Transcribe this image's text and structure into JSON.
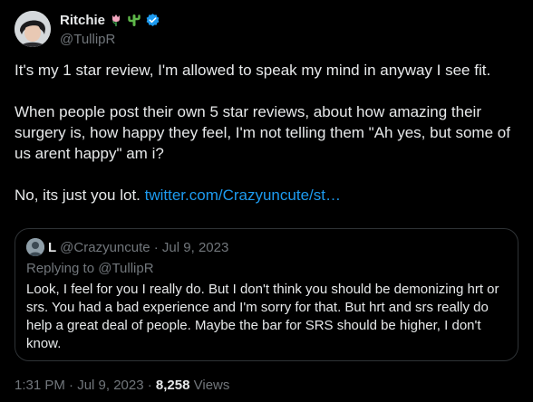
{
  "author": {
    "display_name": "Ritchie",
    "handle": "@TullipR",
    "badges": [
      "tulip-emoji",
      "cactus-emoji",
      "verified-badge-icon"
    ],
    "verified_color": "#1d9bf0"
  },
  "tweet": {
    "paragraph_1": "It's my 1 star review, I'm allowed to speak my mind in anyway I see fit.",
    "paragraph_2": "When people post their own 5 star reviews, about how amazing their surgery is, how happy they feel, I'm not telling them \"Ah yes, but some of us arent happy\" am i?",
    "paragraph_3_text": "No, its just you lot. ",
    "paragraph_3_link": "twitter.com/Crazyuncute/st…"
  },
  "quoted_tweet": {
    "display_name": "L",
    "handle_date": "@Crazyuncute · Jul 9, 2023",
    "replying_to": "Replying to @TullipR",
    "text": "Look, I feel for you I really do. But I don't think you should be demonizing hrt or srs. You had a bad experience and I'm sorry for that. But hrt and srs really do help a great deal of people. Maybe the bar for SRS should be higher, I don't know."
  },
  "meta": {
    "timestamp": "1:31 PM · Jul 9, 2023 · ",
    "views_count": "8,258",
    "views_label": " Views"
  },
  "colors": {
    "background": "#000000",
    "text": "#e7e9ea",
    "muted": "#71767b",
    "link": "#1d9bf0",
    "border": "#2f3336"
  }
}
